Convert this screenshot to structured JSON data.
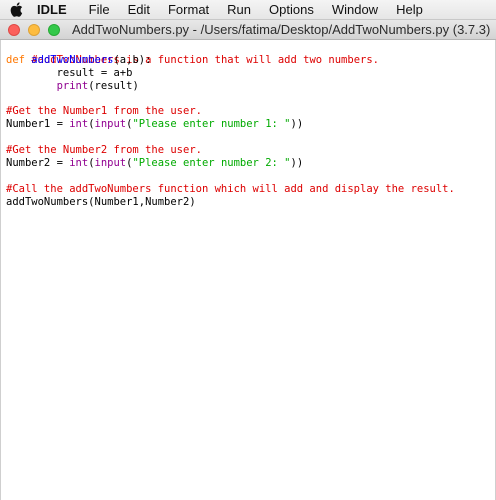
{
  "menubar": {
    "apple_icon": "apple-logo-icon",
    "items": [
      {
        "label": "IDLE"
      },
      {
        "label": "File"
      },
      {
        "label": "Edit"
      },
      {
        "label": "Format"
      },
      {
        "label": "Run"
      },
      {
        "label": "Options"
      },
      {
        "label": "Window"
      },
      {
        "label": "Help"
      }
    ]
  },
  "window": {
    "title": "AddTwoNumbers.py - /Users/fatima/Desktop/AddTwoNumbers.py (3.7.3)"
  },
  "colors": {
    "comment": "#dd0000",
    "keyword": "#ff7700",
    "definition": "#0000ff",
    "builtin": "#900090",
    "string": "#00aa00"
  },
  "code": {
    "l1": {
      "comment": "#addTwoNumbers is a function that will add two numbers."
    },
    "l2": {
      "keyword": "def",
      "space": " ",
      "name": "addTwoNumbers",
      "rest": "(a,b):"
    },
    "l3": {
      "text": "        result = a+b"
    },
    "l4": {
      "indent": "        ",
      "builtin": "print",
      "rest": "(result)"
    },
    "l5": {
      "text": ""
    },
    "l6": {
      "comment": "#Get the Number1 from the user."
    },
    "l7": {
      "a": "Number1 = ",
      "b1": "int",
      "p1": "(",
      "b2": "input",
      "p2": "(",
      "s": "\"Please enter number 1: \"",
      "end": "))"
    },
    "l8": {
      "text": ""
    },
    "l9": {
      "comment": "#Get the Number2 from the user."
    },
    "l10": {
      "a": "Number2 = ",
      "b1": "int",
      "p1": "(",
      "b2": "input",
      "p2": "(",
      "s": "\"Please enter number 2: \"",
      "end": "))"
    },
    "l11": {
      "text": ""
    },
    "l12": {
      "comment": "#Call the addTwoNumbers function which will add and display the result."
    },
    "l13": {
      "text": "addTwoNumbers(Number1,Number2)"
    }
  }
}
